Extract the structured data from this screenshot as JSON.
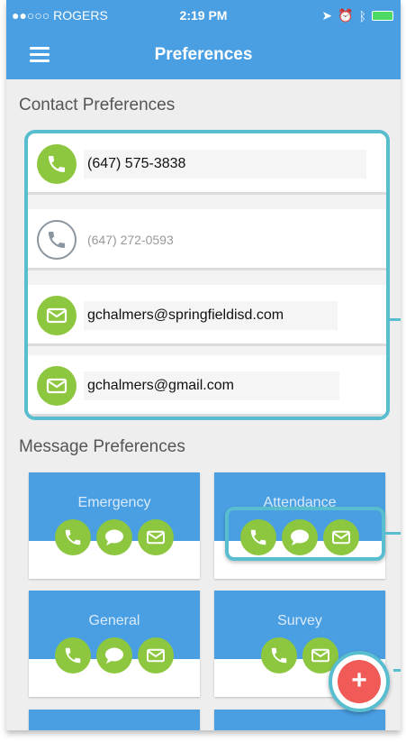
{
  "status_bar": {
    "carrier": "●●○○○ ROGERS",
    "time": "2:19 PM"
  },
  "header": {
    "title": "Preferences"
  },
  "contact_preferences": {
    "title": "Contact Preferences",
    "rows": [
      {
        "icon": "phone-icon",
        "value": "(647) 575-3838",
        "active": true
      },
      {
        "icon": "phone-icon",
        "value": "(647) 272-0593",
        "active": false
      },
      {
        "icon": "mail-icon",
        "value": "gchalmers@springfieldisd.com",
        "active": true
      },
      {
        "icon": "mail-icon",
        "value": "gchalmers@gmail.com",
        "active": true
      }
    ]
  },
  "message_preferences": {
    "title": "Message Preferences",
    "tiles": [
      {
        "label": "Emergency",
        "icons": [
          "phone-icon",
          "chat-icon",
          "mail-icon"
        ]
      },
      {
        "label": "Attendance",
        "icons": [
          "phone-icon",
          "chat-icon",
          "mail-icon"
        ]
      },
      {
        "label": "General",
        "icons": [
          "phone-icon",
          "chat-icon",
          "mail-icon"
        ]
      },
      {
        "label": "Survey",
        "icons": [
          "phone-icon",
          "mail-icon"
        ]
      }
    ]
  },
  "fab": {
    "label": "+"
  },
  "colors": {
    "header": "#4a9fe3",
    "accent_green": "#8dc73f",
    "highlight": "#58bdcf",
    "fab": "#f05a57"
  }
}
